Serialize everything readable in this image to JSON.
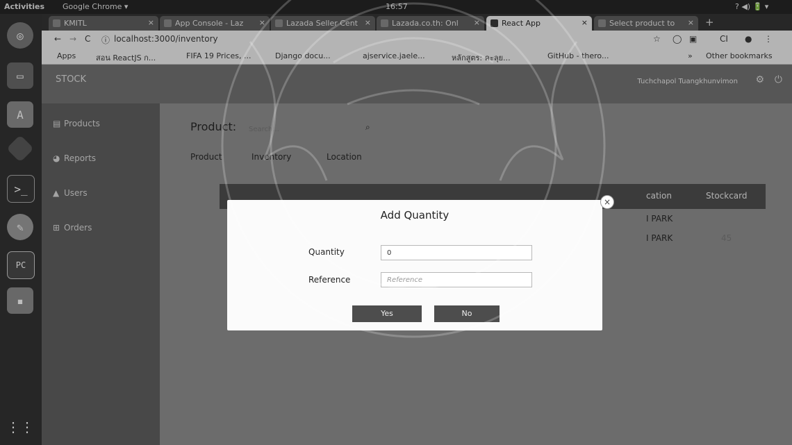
{
  "system_bar": {
    "activities": "Activities",
    "app_menu": "Google Chrome ▾",
    "clock": "16:57",
    "tray": "? ◀) 🔋 ▾"
  },
  "browser": {
    "tabs": [
      {
        "label": "KMITL",
        "active": false
      },
      {
        "label": "App Console - Laz",
        "active": false
      },
      {
        "label": "Lazada Seller Cent",
        "active": false
      },
      {
        "label": "Lazada.co.th: Onl",
        "active": false
      },
      {
        "label": "React App",
        "active": true
      },
      {
        "label": "Select product to",
        "active": false
      }
    ],
    "new_tab": "+",
    "url": "localhost:3000/inventory",
    "bookmarks": [
      "Apps",
      "สอน ReactJS ก...",
      "FIFA 19 Prices, ...",
      "Django docu...",
      "ajservice.jaele...",
      "หลักสูตร: คะลุย...",
      "GitHub - thero..."
    ],
    "more_bookmarks": "»",
    "other_bookmarks": "Other bookmarks"
  },
  "app": {
    "brand": "STOCK",
    "user_name": "Tuchchapol Tuangkhunvimon",
    "sidebar": [
      {
        "label": "Products",
        "icon": "products-icon"
      },
      {
        "label": "Reports",
        "icon": "reports-icon"
      },
      {
        "label": "Users",
        "icon": "users-icon"
      },
      {
        "label": "Orders",
        "icon": "orders-icon"
      }
    ],
    "search": {
      "label": "Product:",
      "placeholder": "Search..."
    },
    "subtabs": [
      "Product",
      "Inventory",
      "Location"
    ],
    "table_headers": [
      "cation",
      "Stockcard"
    ],
    "rows": [
      {
        "location": "I PARK",
        "stockcard": ""
      },
      {
        "location": "I PARK",
        "stockcard": "45"
      }
    ]
  },
  "modal": {
    "title": "Add Quantity",
    "quantity_label": "Quantity",
    "quantity_value": "0",
    "reference_label": "Reference",
    "reference_placeholder": "Reference",
    "yes": "Yes",
    "no": "No",
    "close": "×"
  }
}
